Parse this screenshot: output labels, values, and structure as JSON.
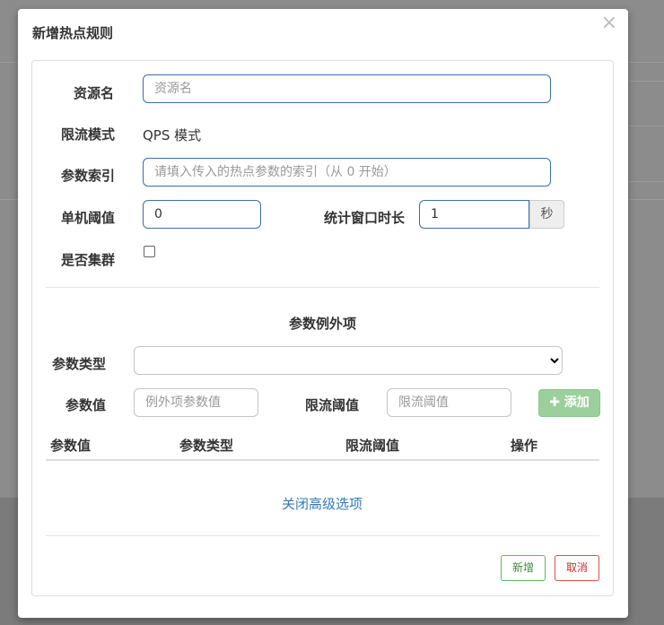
{
  "modal": {
    "title": "新增热点规则",
    "close_glyph": "×"
  },
  "form": {
    "resource_label": "资源名",
    "resource_placeholder": "资源名",
    "limit_mode_label": "限流模式",
    "limit_mode_value": "QPS 模式",
    "param_index_label": "参数索引",
    "param_index_placeholder": "请填入传入的热点参数的索引（从 0 开始）",
    "threshold_label": "单机阈值",
    "threshold_value": "0",
    "window_label": "统计窗口时长",
    "window_value": "1",
    "window_unit": "秒",
    "cluster_label": "是否集群"
  },
  "exceptions": {
    "title": "参数例外项",
    "type_label": "参数类型",
    "value_label": "参数值",
    "value_placeholder": "例外项参数值",
    "limit_label": "限流阈值",
    "limit_placeholder": "限流阈值",
    "add_button": "添加",
    "table_headers": [
      "参数值",
      "参数类型",
      "限流阈值",
      "操作"
    ]
  },
  "advanced_link": "关闭高级选项",
  "footer": {
    "add_button": "新增",
    "cancel_button": "取消"
  },
  "colors": {
    "add_green": "#9bd09c",
    "link_blue": "#337ab7",
    "cancel_red": "#d9534f"
  }
}
